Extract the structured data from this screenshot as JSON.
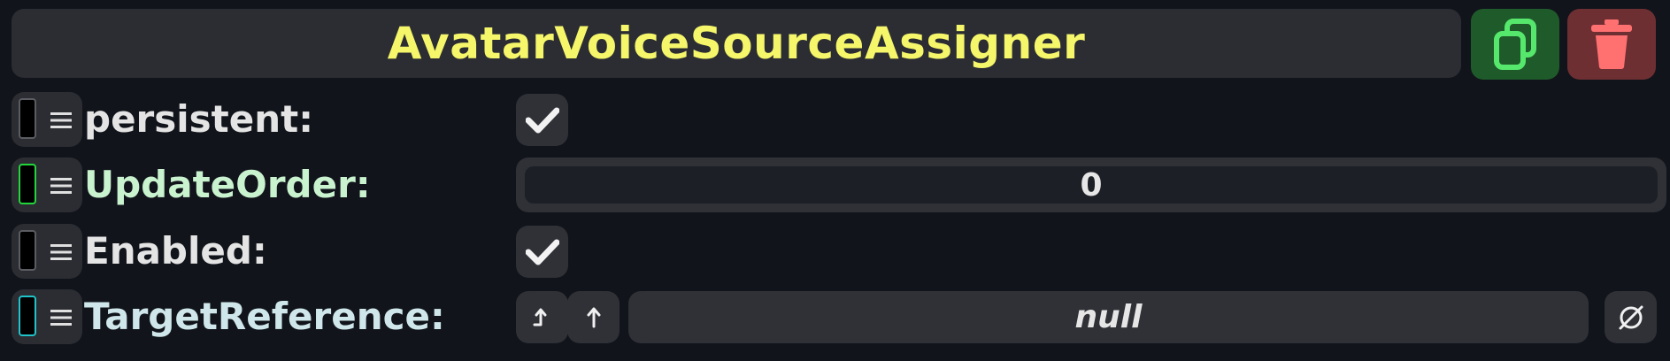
{
  "header": {
    "title": "AvatarVoiceSourceAssigner",
    "title_color": "#f6f66a",
    "duplicate_icon": "duplicate-icon",
    "delete_icon": "trash-icon"
  },
  "fields": [
    {
      "label": "persistent:",
      "label_color": "#e4e4e4",
      "slot_color": "#000000",
      "slot_border": "#5a5c62",
      "value": true
    },
    {
      "label": "UpdateOrder:",
      "label_color": "#c9f2cf",
      "slot_color": "#000000",
      "slot_border": "#22d63a",
      "value": "0"
    },
    {
      "label": "Enabled:",
      "label_color": "#e4e4e4",
      "slot_color": "#000000",
      "slot_border": "#5a5c62",
      "value": true
    },
    {
      "label": "TargetReference:",
      "label_color": "#cfe7ea",
      "slot_color": "#000000",
      "slot_border": "#1fc3c9",
      "value": "null",
      "jump_icon": "jump-to-icon",
      "up_icon": "up-arrow-icon",
      "clear_icon": "null-icon"
    }
  ]
}
